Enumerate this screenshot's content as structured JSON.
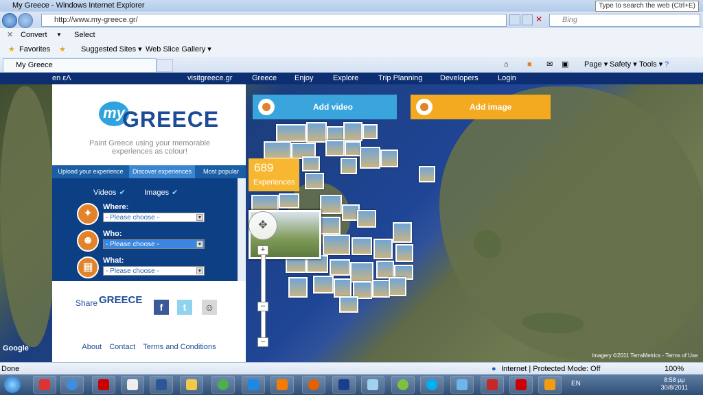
{
  "browser": {
    "title": "My Greece - Windows Internet Explorer",
    "search_tip": "Type to search the web (Ctrl+E)",
    "url": "http://www.my-greece.gr/",
    "search_placeholder": "Bing",
    "cmd": {
      "convert": "Convert",
      "select": "Select"
    },
    "favorites": {
      "label": "Favorites",
      "suggested": "Suggested Sites ▾",
      "webslice": "Web Slice Gallery ▾"
    },
    "tab_title": "My Greece",
    "tools": {
      "page": "Page ▾",
      "safety": "Safety ▾",
      "tools": "Tools ▾"
    }
  },
  "sitenav": {
    "lang": "en εΛ",
    "items": [
      "visitgreece.gr",
      "Greece",
      "Enjoy",
      "Explore",
      "Trip Planning",
      "Developers",
      "Login"
    ]
  },
  "panel": {
    "logo_my": "my",
    "logo_greece": "GREECE",
    "tagline": "Paint Greece using your memorable experiences as colour!",
    "tabs": [
      "Upload your experience",
      "Discover experiences",
      "Most popular"
    ],
    "filters": {
      "videos": "Videos",
      "images": "Images",
      "where_label": "Where:",
      "where_value": "- Please choose -",
      "who_label": "Who:",
      "who_value": "- Please choose -",
      "what_label": "What:",
      "what_value": "- Please choose -"
    },
    "share": "Share",
    "share_logo": "GREECE",
    "footer": [
      "About",
      "Contact",
      "Terms and Conditions"
    ]
  },
  "map": {
    "add_video": "Add video",
    "add_image": "Add image",
    "count": "689",
    "count_label": "Experiences",
    "imagery": "Imagery ©2011 TerraMetrics - Terms of Use",
    "google": "Google"
  },
  "status": {
    "done": "Done",
    "zone": "Internet | Protected Mode: Off",
    "zoom": "100%"
  },
  "taskbar": {
    "lang": "EN",
    "time": "8:58 μμ",
    "date": "30/8/2011"
  }
}
